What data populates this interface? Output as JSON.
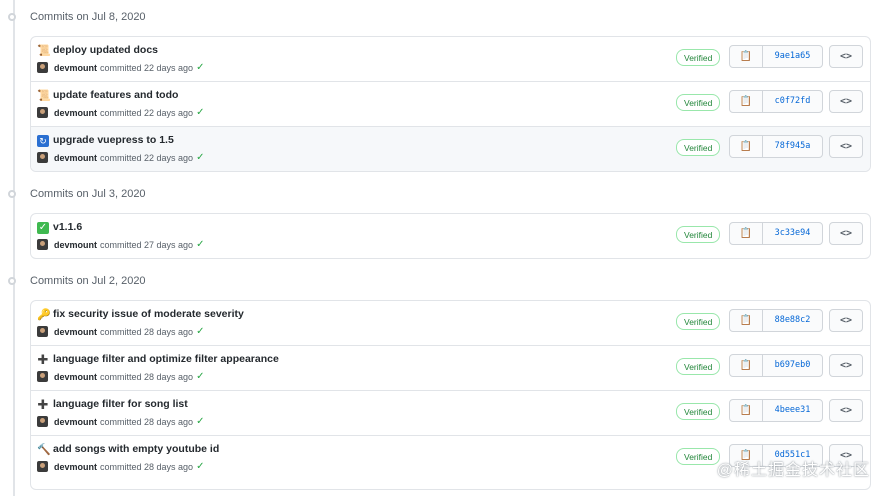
{
  "groups": [
    {
      "label": "Commits on Jul 8, 2020",
      "commits": [
        {
          "icon": "scroll-icon",
          "message": "deploy updated docs",
          "author": "devmount",
          "time_text": "committed 22 days ago",
          "verified": "Verified",
          "sha": "9ae1a65"
        },
        {
          "icon": "scroll-icon",
          "message": "update features and todo",
          "author": "devmount",
          "time_text": "committed 22 days ago",
          "verified": "Verified",
          "sha": "c0f72fd"
        },
        {
          "icon": "update-icon",
          "message": "upgrade vuepress to 1.5",
          "author": "devmount",
          "time_text": "committed 22 days ago",
          "verified": "Verified",
          "sha": "78f945a"
        }
      ]
    },
    {
      "label": "Commits on Jul 3, 2020",
      "commits": [
        {
          "icon": "check-box-icon",
          "message": "v1.1.6",
          "author": "devmount",
          "time_text": "committed 27 days ago",
          "verified": "Verified",
          "sha": "3c33e94"
        }
      ]
    },
    {
      "label": "Commits on Jul 2, 2020",
      "commits": [
        {
          "icon": "key-icon",
          "message": "fix security issue of moderate severity",
          "author": "devmount",
          "time_text": "committed 28 days ago",
          "verified": "Verified",
          "sha": "88e88c2"
        },
        {
          "icon": "plus-icon",
          "message": "language filter and optimize filter appearance",
          "author": "devmount",
          "time_text": "committed 28 days ago",
          "verified": "Verified",
          "sha": "b697eb0"
        },
        {
          "icon": "plus-icon",
          "message": "language filter for song list",
          "author": "devmount",
          "time_text": "committed 28 days ago",
          "verified": "Verified",
          "sha": "4beee31"
        },
        {
          "icon": "hammer-icon",
          "message": "add songs with empty youtube id",
          "author": "devmount",
          "time_text": "committed 28 days ago",
          "verified": "Verified",
          "sha": "0d551c1"
        }
      ]
    }
  ],
  "buttons": {
    "copy_icon": "clipboard-icon",
    "browse_label": "<>"
  },
  "watermark": "@稀土掘金技术社区",
  "colors": {
    "verified": "#22863a",
    "sha": "#0366d6",
    "check": "#28a745"
  }
}
